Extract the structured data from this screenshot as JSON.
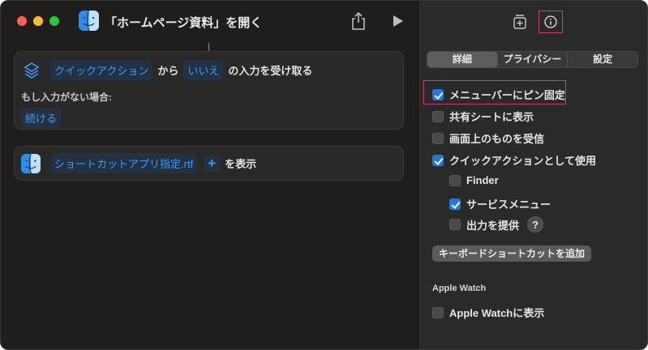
{
  "window": {
    "title": "「ホームページ資料」を開く"
  },
  "editor": {
    "card1": {
      "token_quick_action": "クイックアクション",
      "text_from": "から",
      "token_no": "いいえ",
      "text_accept": "の入力を受け取る",
      "if_no_input_label": "もし入力がない場合:",
      "continue_token": "続ける"
    },
    "card2": {
      "file_token": "ショートカットアプリ指定.rtf",
      "plus": "+",
      "text_show": "を表示"
    }
  },
  "inspector": {
    "tabs": [
      "詳細",
      "プライバシー",
      "設定"
    ],
    "active_tab": "詳細",
    "options": [
      {
        "label": "メニューバーにピン固定",
        "checked": true
      },
      {
        "label": "共有シートに表示",
        "checked": false
      },
      {
        "label": "画面上のものを受信",
        "checked": false
      },
      {
        "label": "クイックアクションとして使用",
        "checked": true
      },
      {
        "label": "Finder",
        "checked": false
      },
      {
        "label": "サービスメニュー",
        "checked": true
      },
      {
        "label": "出力を提供",
        "checked": false
      }
    ],
    "help_symbol": "?",
    "add_shortcut_button": "キーボードショートカットを追加",
    "apple_watch_section": "Apple Watch",
    "apple_watch_option": {
      "label": "Apple Watchに表示",
      "checked": false
    }
  },
  "icons": {
    "app": "finder-icon",
    "share": "share-icon",
    "run": "play-icon",
    "quick_action": "quick-action-icon",
    "add_widget": "add-widget-icon",
    "info": "info-icon"
  },
  "colors": {
    "accent": "#1f7ae0",
    "token_text": "#3b9cff",
    "highlight": "#d23c78"
  }
}
